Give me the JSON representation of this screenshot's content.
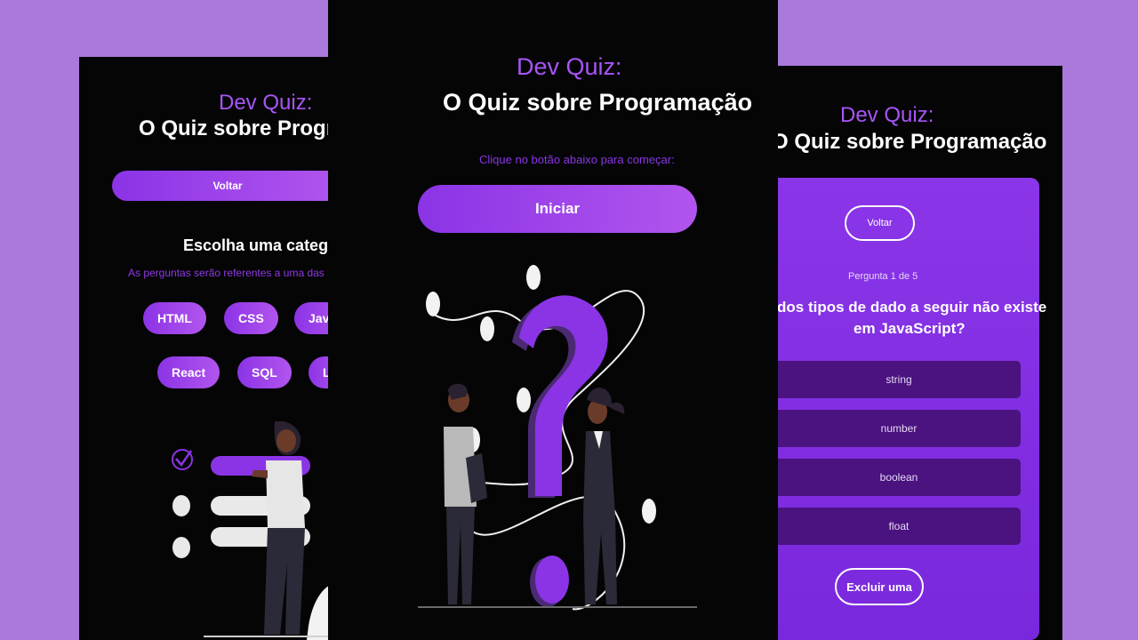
{
  "app": {
    "title_line1": "Dev Quiz:",
    "title_line2": "O Quiz sobre Programação",
    "title_line2_right_clip": "O Quiz sobre Programação",
    "title_line2_left_clip": "O Quiz sobre Program"
  },
  "left_screen": {
    "back_button": "Voltar",
    "heading": "Escolha uma categor",
    "subtitle": "As perguntas serão referentes a uma das ling",
    "categories": [
      "HTML",
      "CSS",
      "Java",
      "React",
      "SQL",
      "L"
    ]
  },
  "center_screen": {
    "instruction": "Clique no botão abaixo para começar:",
    "start_button": "Iniciar"
  },
  "right_screen": {
    "back_button": "Voltar",
    "question_counter": "Pergunta 1 de 5",
    "question_line1": "dos tipos de dado a seguir não existe",
    "question_line2": "em JavaScript?",
    "options": [
      "string",
      "number",
      "boolean",
      "float"
    ],
    "eliminate_button": "Excluir uma"
  },
  "colors": {
    "background": "#a97adb",
    "screen": "#050505",
    "accent": "#a855f7",
    "card": "#8a35e8",
    "option": "#4a137f"
  }
}
